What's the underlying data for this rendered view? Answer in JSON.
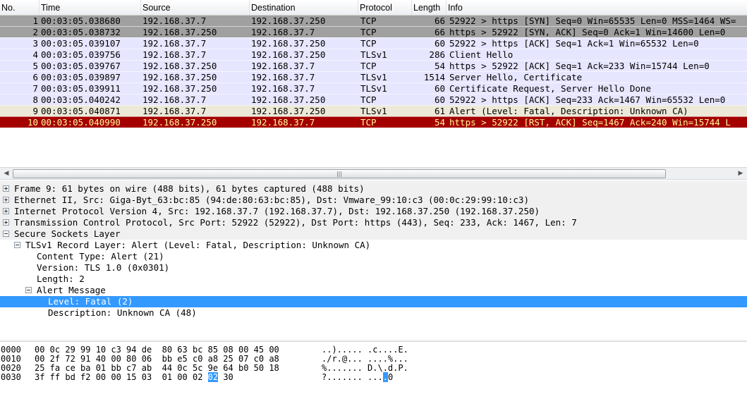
{
  "packet_list": {
    "columns": [
      "No.",
      "Time",
      "Source",
      "Destination",
      "Protocol",
      "Length",
      "Info"
    ],
    "rows": [
      {
        "no": "1",
        "time": "00:03:05.038680",
        "src": "192.168.37.7",
        "dst": "192.168.37.250",
        "proto": "TCP",
        "len": "66",
        "info": "52922 > https [SYN] Seq=0 Win=65535 Len=0 MSS=1464 WS=",
        "style": "syn"
      },
      {
        "no": "2",
        "time": "00:03:05.038732",
        "src": "192.168.37.250",
        "dst": "192.168.37.7",
        "proto": "TCP",
        "len": "66",
        "info": "https > 52922 [SYN, ACK] Seq=0 Ack=1 Win=14600 Len=0",
        "style": "syn"
      },
      {
        "no": "3",
        "time": "00:03:05.039107",
        "src": "192.168.37.7",
        "dst": "192.168.37.250",
        "proto": "TCP",
        "len": "60",
        "info": "52922 > https [ACK] Seq=1 Ack=1 Win=65532 Len=0",
        "style": "tcp"
      },
      {
        "no": "4",
        "time": "00:03:05.039756",
        "src": "192.168.37.7",
        "dst": "192.168.37.250",
        "proto": "TLSv1",
        "len": "286",
        "info": "Client Hello",
        "style": "tls"
      },
      {
        "no": "5",
        "time": "00:03:05.039767",
        "src": "192.168.37.250",
        "dst": "192.168.37.7",
        "proto": "TCP",
        "len": "54",
        "info": "https > 52922 [ACK] Seq=1 Ack=233 Win=15744 Len=0",
        "style": "tcp"
      },
      {
        "no": "6",
        "time": "00:03:05.039897",
        "src": "192.168.37.250",
        "dst": "192.168.37.7",
        "proto": "TLSv1",
        "len": "1514",
        "info": "Server Hello, Certificate",
        "style": "tls"
      },
      {
        "no": "7",
        "time": "00:03:05.039911",
        "src": "192.168.37.250",
        "dst": "192.168.37.7",
        "proto": "TLSv1",
        "len": "60",
        "info": "Certificate Request, Server Hello Done",
        "style": "tls"
      },
      {
        "no": "8",
        "time": "00:03:05.040242",
        "src": "192.168.37.7",
        "dst": "192.168.37.250",
        "proto": "TCP",
        "len": "60",
        "info": "52922 > https [ACK] Seq=233 Ack=1467 Win=65532 Len=0",
        "style": "tcp"
      },
      {
        "no": "9",
        "time": "00:03:05.040871",
        "src": "192.168.37.7",
        "dst": "192.168.37.250",
        "proto": "TLSv1",
        "len": "61",
        "info": "Alert (Level: Fatal, Description: Unknown CA)",
        "style": "alert"
      },
      {
        "no": "10",
        "time": "00:03:05.040990",
        "src": "192.168.37.250",
        "dst": "192.168.37.7",
        "proto": "TCP",
        "len": "54",
        "info": "https > 52922 [RST, ACK] Seq=1467 Ack=240 Win=15744 L",
        "style": "rst"
      }
    ]
  },
  "scrollbar": {
    "left_arrow": "◀",
    "right_arrow": "▶",
    "grip": "|||"
  },
  "details": {
    "rows": [
      {
        "text": "Frame 9: 61 bytes on wire (488 bits), 61 bytes captured (488 bits)",
        "expander": "plus",
        "level": 0,
        "kind": "top"
      },
      {
        "text": "Ethernet II, Src: Giga-Byt_63:bc:85 (94:de:80:63:bc:85), Dst: Vmware_99:10:c3 (00:0c:29:99:10:c3)",
        "expander": "plus",
        "level": 0,
        "kind": "top"
      },
      {
        "text": "Internet Protocol Version 4, Src: 192.168.37.7 (192.168.37.7), Dst: 192.168.37.250 (192.168.37.250)",
        "expander": "plus",
        "level": 0,
        "kind": "top"
      },
      {
        "text": "Transmission Control Protocol, Src Port: 52922 (52922), Dst Port: https (443), Seq: 233, Ack: 1467, Len: 7",
        "expander": "plus",
        "level": 0,
        "kind": "top"
      },
      {
        "text": "Secure Sockets Layer",
        "expander": "minus",
        "level": 0,
        "kind": "top"
      },
      {
        "text": "TLSv1 Record Layer: Alert (Level: Fatal, Description: Unknown CA)",
        "expander": "minus",
        "level": 1,
        "kind": "plain"
      },
      {
        "text": "Content Type: Alert (21)",
        "expander": "none",
        "level": 2,
        "kind": "plain"
      },
      {
        "text": "Version: TLS 1.0 (0x0301)",
        "expander": "none",
        "level": 2,
        "kind": "plain"
      },
      {
        "text": "Length: 2",
        "expander": "none",
        "level": 2,
        "kind": "plain"
      },
      {
        "text": "Alert Message",
        "expander": "minus",
        "level": 2,
        "kind": "plain"
      },
      {
        "text": "Level: Fatal (2)",
        "expander": "none",
        "level": 3,
        "kind": "selected"
      },
      {
        "text": "Description: Unknown CA (48)",
        "expander": "none",
        "level": 3,
        "kind": "plain"
      }
    ]
  },
  "bytes": {
    "rows": [
      {
        "offset": "0000",
        "hex_pre": "00 0c 29 99 10 c3 94 de  80 63 bc 85 08 00 45 00",
        "hex_hl": "",
        "hex_post": "",
        "ascii_pre": "..)..... .c....E.",
        "ascii_hl": "",
        "ascii_post": ""
      },
      {
        "offset": "0010",
        "hex_pre": "00 2f 72 91 40 00 80 06  bb e5 c0 a8 25 07 c0 a8",
        "hex_hl": "",
        "hex_post": "",
        "ascii_pre": "./r.@... ....%...",
        "ascii_hl": "",
        "ascii_post": ""
      },
      {
        "offset": "0020",
        "hex_pre": "25 fa ce ba 01 bb c7 ab  44 0c 5c 9e 64 b0 50 18",
        "hex_hl": "",
        "hex_post": "",
        "ascii_pre": "%....... D.\\.d.P.",
        "ascii_hl": "",
        "ascii_post": ""
      },
      {
        "offset": "0030",
        "hex_pre": "3f ff bd f2 00 00 15 03  01 00 02 ",
        "hex_hl": "02",
        "hex_post": " 30",
        "ascii_pre": "?....... ...",
        "ascii_hl": ".",
        "ascii_post": "0"
      }
    ]
  }
}
